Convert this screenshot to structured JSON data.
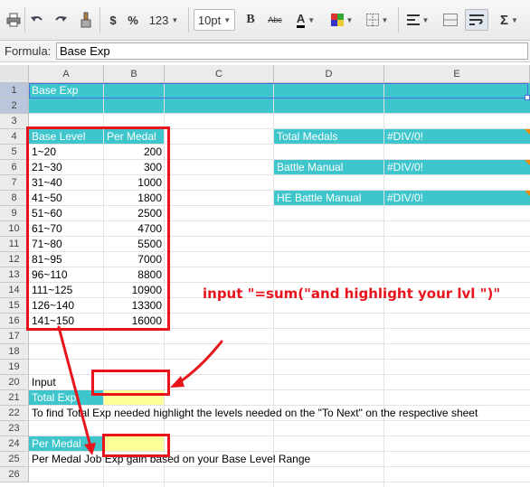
{
  "toolbar": {
    "format_dollar": "$",
    "format_percent": "%",
    "format_more": "123",
    "font_size": "10pt",
    "bold": "B",
    "strike": "Abc",
    "text_color": "A",
    "sum": "Σ"
  },
  "formula_bar": {
    "label": "Formula:",
    "value": "Base Exp"
  },
  "columns": [
    "A",
    "B",
    "C",
    "D",
    "E"
  ],
  "rows": [
    "1",
    "2",
    "3",
    "4",
    "5",
    "6",
    "7",
    "8",
    "9",
    "10",
    "11",
    "12",
    "13",
    "14",
    "15",
    "16",
    "17",
    "18",
    "19",
    "20",
    "21",
    "22",
    "23",
    "24",
    "25",
    "26"
  ],
  "cells": {
    "a1": "Base Exp",
    "a4": "Base Level",
    "b4": "Per Medal",
    "d4": "Total Medals",
    "e4": "#DIV/0!",
    "d6": "Battle Manual",
    "e6": "#DIV/0!",
    "d8": "HE Battle Manual",
    "e8": "#DIV/0!",
    "a20": "Input",
    "a21": "Total Exp",
    "a22": "To find Total Exp needed highlight the levels needed on the \"To Next\" on the respective sheet",
    "a24": "Per Medal",
    "a25": "Per Medal Job Exp gain based on your Base Level Range"
  },
  "level_table": [
    {
      "level": "1~20",
      "per_medal": "200"
    },
    {
      "level": "21~30",
      "per_medal": "300"
    },
    {
      "level": "31~40",
      "per_medal": "1000"
    },
    {
      "level": "41~50",
      "per_medal": "1800"
    },
    {
      "level": "51~60",
      "per_medal": "2500"
    },
    {
      "level": "61~70",
      "per_medal": "4700"
    },
    {
      "level": "71~80",
      "per_medal": "5500"
    },
    {
      "level": "81~95",
      "per_medal": "7000"
    },
    {
      "level": "96~110",
      "per_medal": "8800"
    },
    {
      "level": "111~125",
      "per_medal": "10900"
    },
    {
      "level": "126~140",
      "per_medal": "13300"
    },
    {
      "level": "141~150",
      "per_medal": "16000"
    }
  ],
  "annotation": "input \"=sum(\"and highlight your lvl \")\"",
  "colors": {
    "teal": "#3ec6cc",
    "annotation_red": "#e8141c",
    "input_yellow": "#ffff99"
  }
}
